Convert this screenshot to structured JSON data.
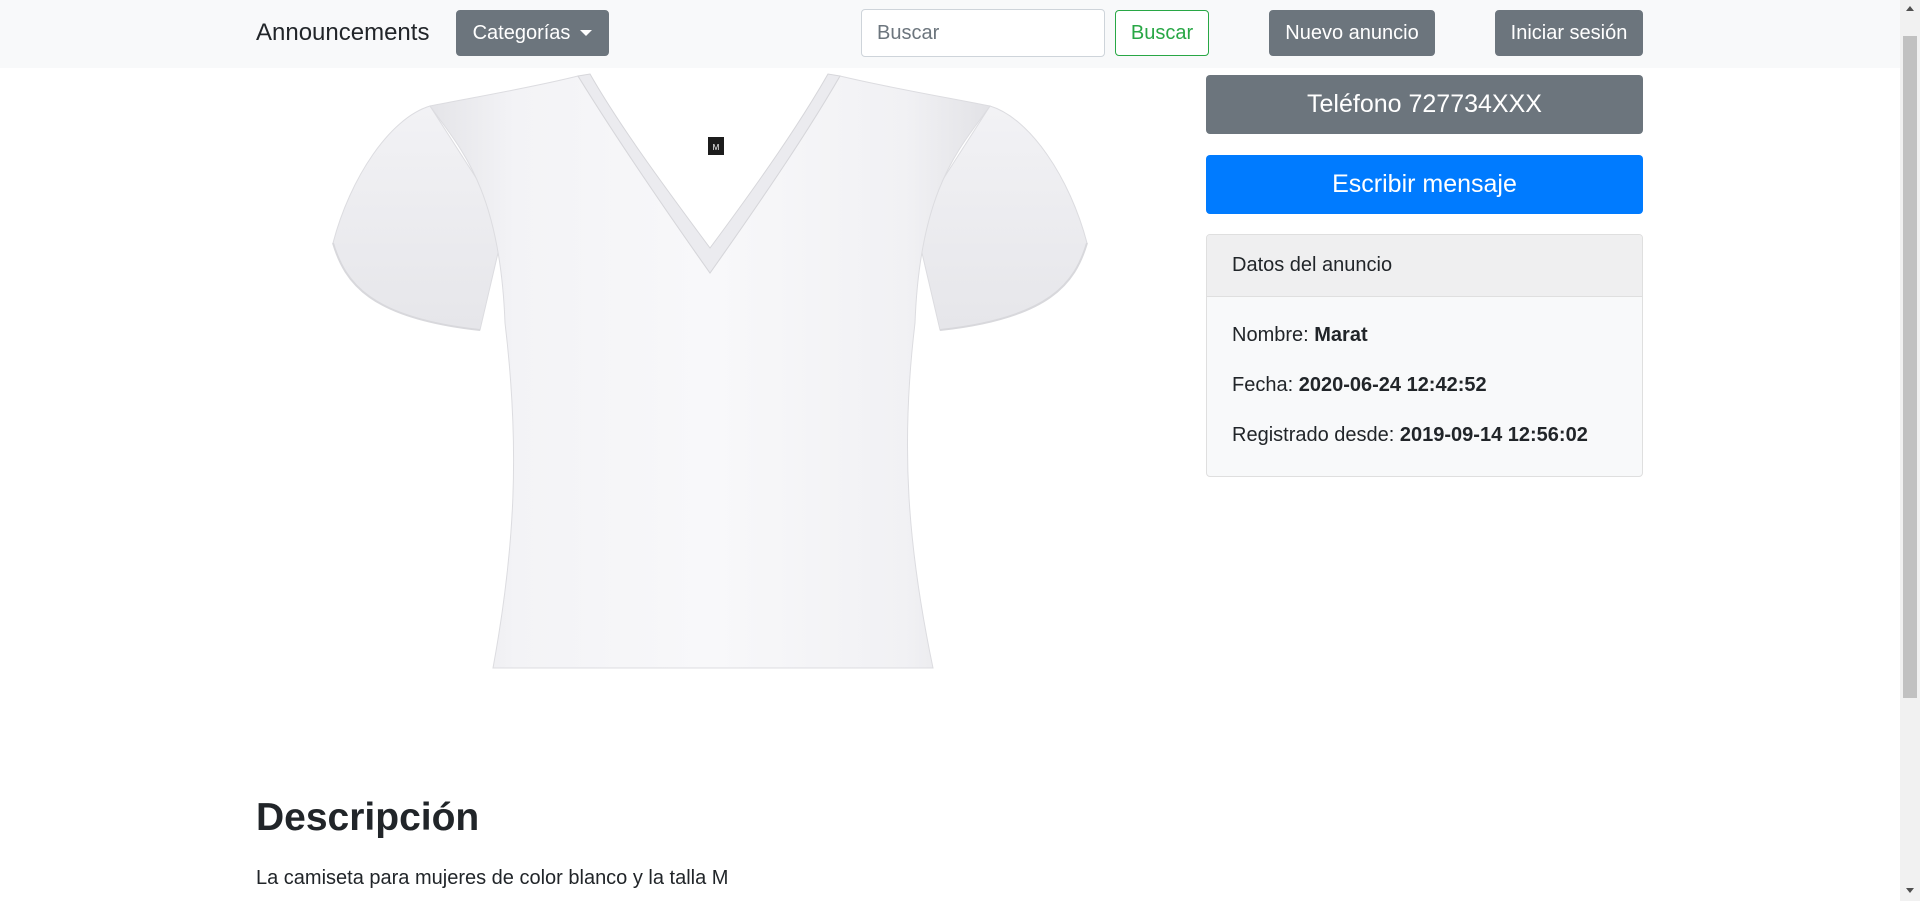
{
  "navbar": {
    "brand": "Announcements",
    "categories_label": "Categorías",
    "search_placeholder": "Buscar",
    "search_button": "Buscar",
    "new_ad_button": "Nuevo anuncio",
    "login_button": "Iniciar sesión"
  },
  "product": {
    "image_icon": "white-v-neck-tshirt-image",
    "size_tag": "M"
  },
  "contact": {
    "phone_button": "Teléfono 727734XXX",
    "message_button": "Escribir mensaje"
  },
  "ad_details": {
    "header": "Datos del anuncio",
    "name_label": "Nombre: ",
    "name_value": "Marat",
    "date_label": "Fecha: ",
    "date_value": "2020-06-24 12:42:52",
    "registered_label": "Registrado desde: ",
    "registered_value": "2019-09-14 12:56:02"
  },
  "description": {
    "title": "Descripción",
    "text": "La camiseta para mujeres de color blanco y la talla M"
  },
  "colors": {
    "navbar_bg": "#f8f9fa",
    "secondary": "#6c757d",
    "primary": "#007bff",
    "success": "#28a745"
  }
}
